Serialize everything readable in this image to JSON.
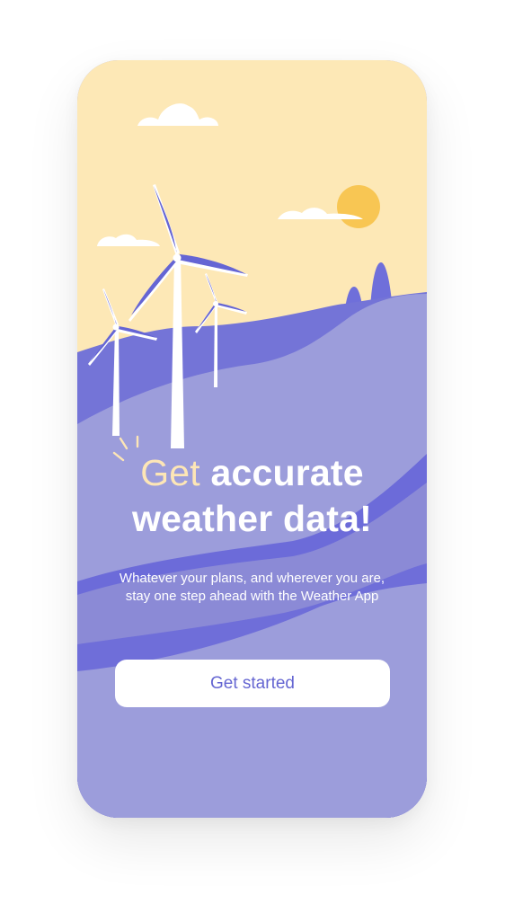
{
  "onboarding": {
    "headline_accent": "Get",
    "headline_rest_line1": "accurate",
    "headline_line2": "weather data!",
    "subtitle": "Whatever your plans, and wherever you are, stay one step ahead with the Weather App",
    "cta_label": "Get started"
  },
  "palette": {
    "sky": "#fde8b6",
    "sun": "#f8c653",
    "hill_light": "#9c9ddb",
    "hill_dark": "#6c6bd9",
    "accent_text": "#fde6b6",
    "button_text": "#6566d2"
  },
  "illustration": {
    "icons": [
      "cloud-icon",
      "sun-icon",
      "wind-turbine-icon",
      "hill-icon",
      "tree-icon",
      "sparkle-icon"
    ]
  }
}
